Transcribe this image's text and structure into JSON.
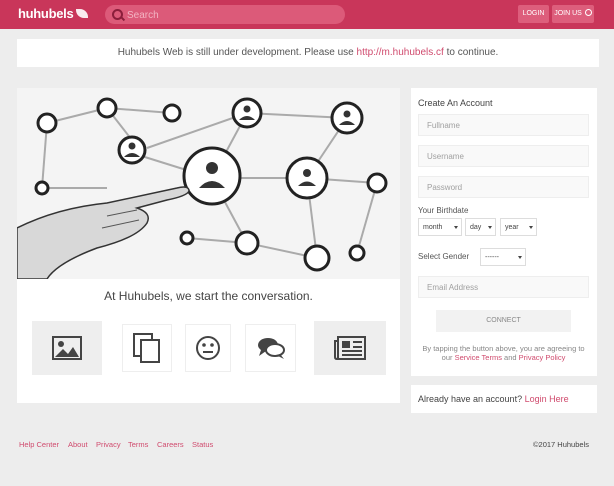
{
  "header": {
    "logo_text": "huhubels",
    "search_placeholder": "Search",
    "login_label": "LOGIN",
    "join_label": "JOIN US"
  },
  "notice": {
    "text_before": "Huhubels Web is still under development. Please use ",
    "link_text": "http://m.huhubels.cf",
    "text_after": " to continue."
  },
  "main": {
    "tagline": "At Huhubels, we start the conversation.",
    "feature_icons": [
      "image-icon",
      "copy-icon",
      "smiley-icon",
      "chat-bubbles-icon",
      "newspaper-icon"
    ]
  },
  "signup": {
    "title": "Create An Account",
    "fullname_placeholder": "Fullname",
    "username_placeholder": "Username",
    "password_placeholder": "Password",
    "birthdate_label": "Your Birthdate",
    "month_label": "month",
    "day_label": "day",
    "year_label": "year",
    "gender_label": "Select Gender",
    "gender_value": "------",
    "email_placeholder": "Email Address",
    "connect_label": "CONNECT",
    "terms_before": "By tapping the button above, you are agreeing to our ",
    "terms_link": "Service Terms",
    "terms_and": " and ",
    "privacy_link": "Privacy Policy"
  },
  "login_prompt": {
    "text": "Already have an account? ",
    "link": "Login Here"
  },
  "footer": {
    "links": [
      "Help Center",
      "About",
      "Privacy",
      "Terms",
      "Careers",
      "Status"
    ],
    "copyright": "©2017 Huhubels"
  },
  "colors": {
    "brand": "#c9365a",
    "link": "#d04b6e"
  }
}
